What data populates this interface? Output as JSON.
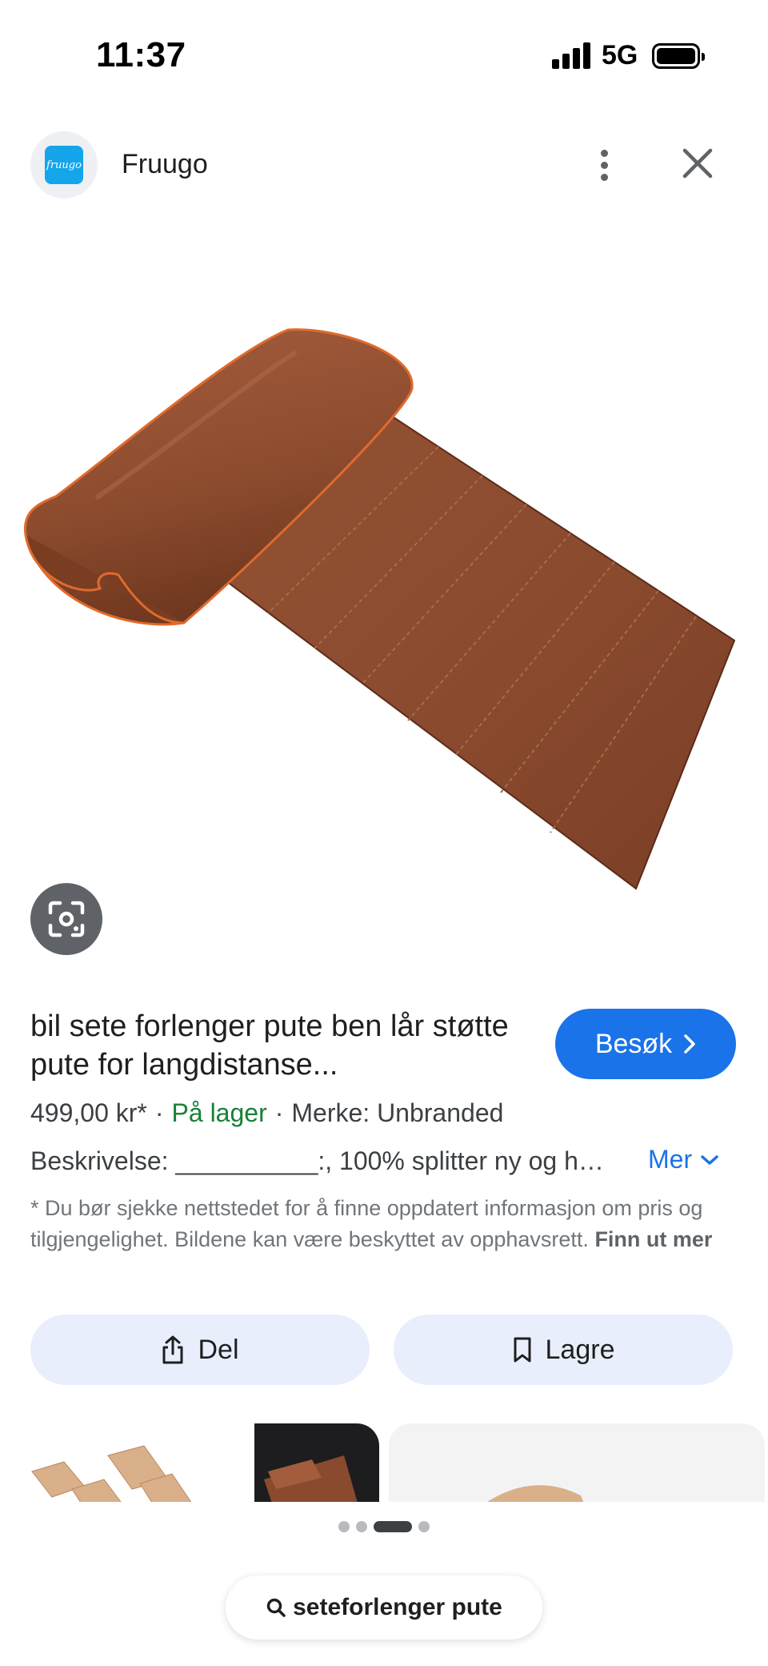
{
  "status_bar": {
    "time": "11:37",
    "network": "5G",
    "signal_bars": 4,
    "battery_level": 1.0
  },
  "header": {
    "logo_text": "fruugo",
    "site_name": "Fruugo",
    "more_icon": "more-vert-icon",
    "close_icon": "close-icon"
  },
  "product": {
    "title": "bil sete forlenger pute ben lår støtte pute for langdistanse...",
    "visit_label": "Besøk",
    "price": "499,00 kr*",
    "stock": "På lager",
    "brand": "Merke: Unbranded",
    "separator": "·",
    "description": "Beskrivelse: __________:, 100% splitter ny og h…",
    "more_label": "Mer",
    "disclaimer": "* Du bør sjekke nettstedet for å finne oppdatert informasjon om pris og tilgjengelighet. Bildene kan være beskyttet av opphavsrett.",
    "learn_more": "Finn ut mer"
  },
  "actions": {
    "share_label": "Del",
    "save_label": "Lagre"
  },
  "pager": {
    "count": 4,
    "active_index": 2
  },
  "search": {
    "query": "seteforlenger pute"
  },
  "colors": {
    "accent": "#1a73e8",
    "stock_green": "#188038",
    "action_bg": "#e8eefb",
    "leather": "#8a4a2e"
  }
}
